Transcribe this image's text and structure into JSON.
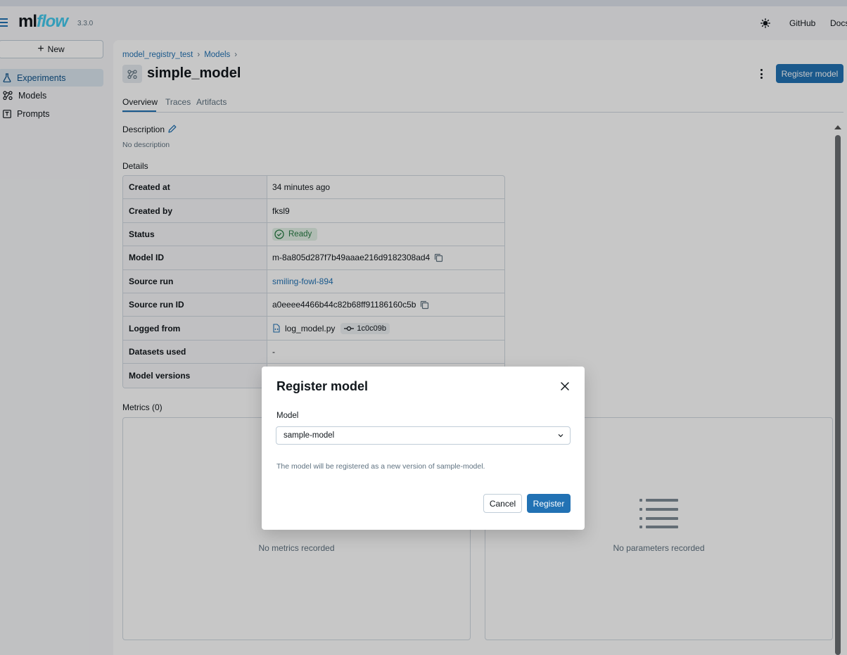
{
  "header": {
    "logo_ml": "ml",
    "logo_flow": "flow",
    "version": "3.3.0",
    "github_label": "GitHub",
    "docs_label": "Docs"
  },
  "sidebar": {
    "new_label": "New",
    "items": [
      {
        "label": "Experiments",
        "icon": "beaker-icon",
        "active": true
      },
      {
        "label": "Models",
        "icon": "models-icon",
        "active": false
      },
      {
        "label": "Prompts",
        "icon": "prompt-icon",
        "active": false
      }
    ]
  },
  "breadcrumb": [
    "model_registry_test",
    "Models"
  ],
  "page": {
    "title": "simple_model",
    "register_button": "Register model"
  },
  "tabs": [
    "Overview",
    "Traces",
    "Artifacts"
  ],
  "description": {
    "label": "Description",
    "value": "No description"
  },
  "details": {
    "label": "Details",
    "rows": {
      "created_at": {
        "key": "Created at",
        "value": "34 minutes ago"
      },
      "created_by": {
        "key": "Created by",
        "value": "fksl9"
      },
      "status": {
        "key": "Status",
        "value": "Ready"
      },
      "model_id": {
        "key": "Model ID",
        "value": "m-8a805d287f7b49aaae216d9182308ad4"
      },
      "source_run": {
        "key": "Source run",
        "value": "smiling-fowl-894"
      },
      "source_run_id": {
        "key": "Source run ID",
        "value": "a0eeee4466b44c82b68ff91186160c5b"
      },
      "logged_from": {
        "key": "Logged from",
        "value": "log_model.py",
        "commit": "1c0c09b"
      },
      "datasets_used": {
        "key": "Datasets used",
        "value": "-"
      },
      "model_versions": {
        "key": "Model versions",
        "value": ""
      }
    }
  },
  "metrics": {
    "label": "Metrics (0)",
    "empty": "No metrics recorded"
  },
  "parameters": {
    "empty": "No parameters recorded"
  },
  "modal": {
    "title": "Register model",
    "field_label": "Model",
    "selected": "sample-model",
    "hint": "The model will be registered as a new version of sample-model.",
    "cancel": "Cancel",
    "confirm": "Register"
  },
  "colors": {
    "accent": "#2272b4",
    "status_green": "#277c43",
    "logo_flow": "#43c9ed"
  }
}
